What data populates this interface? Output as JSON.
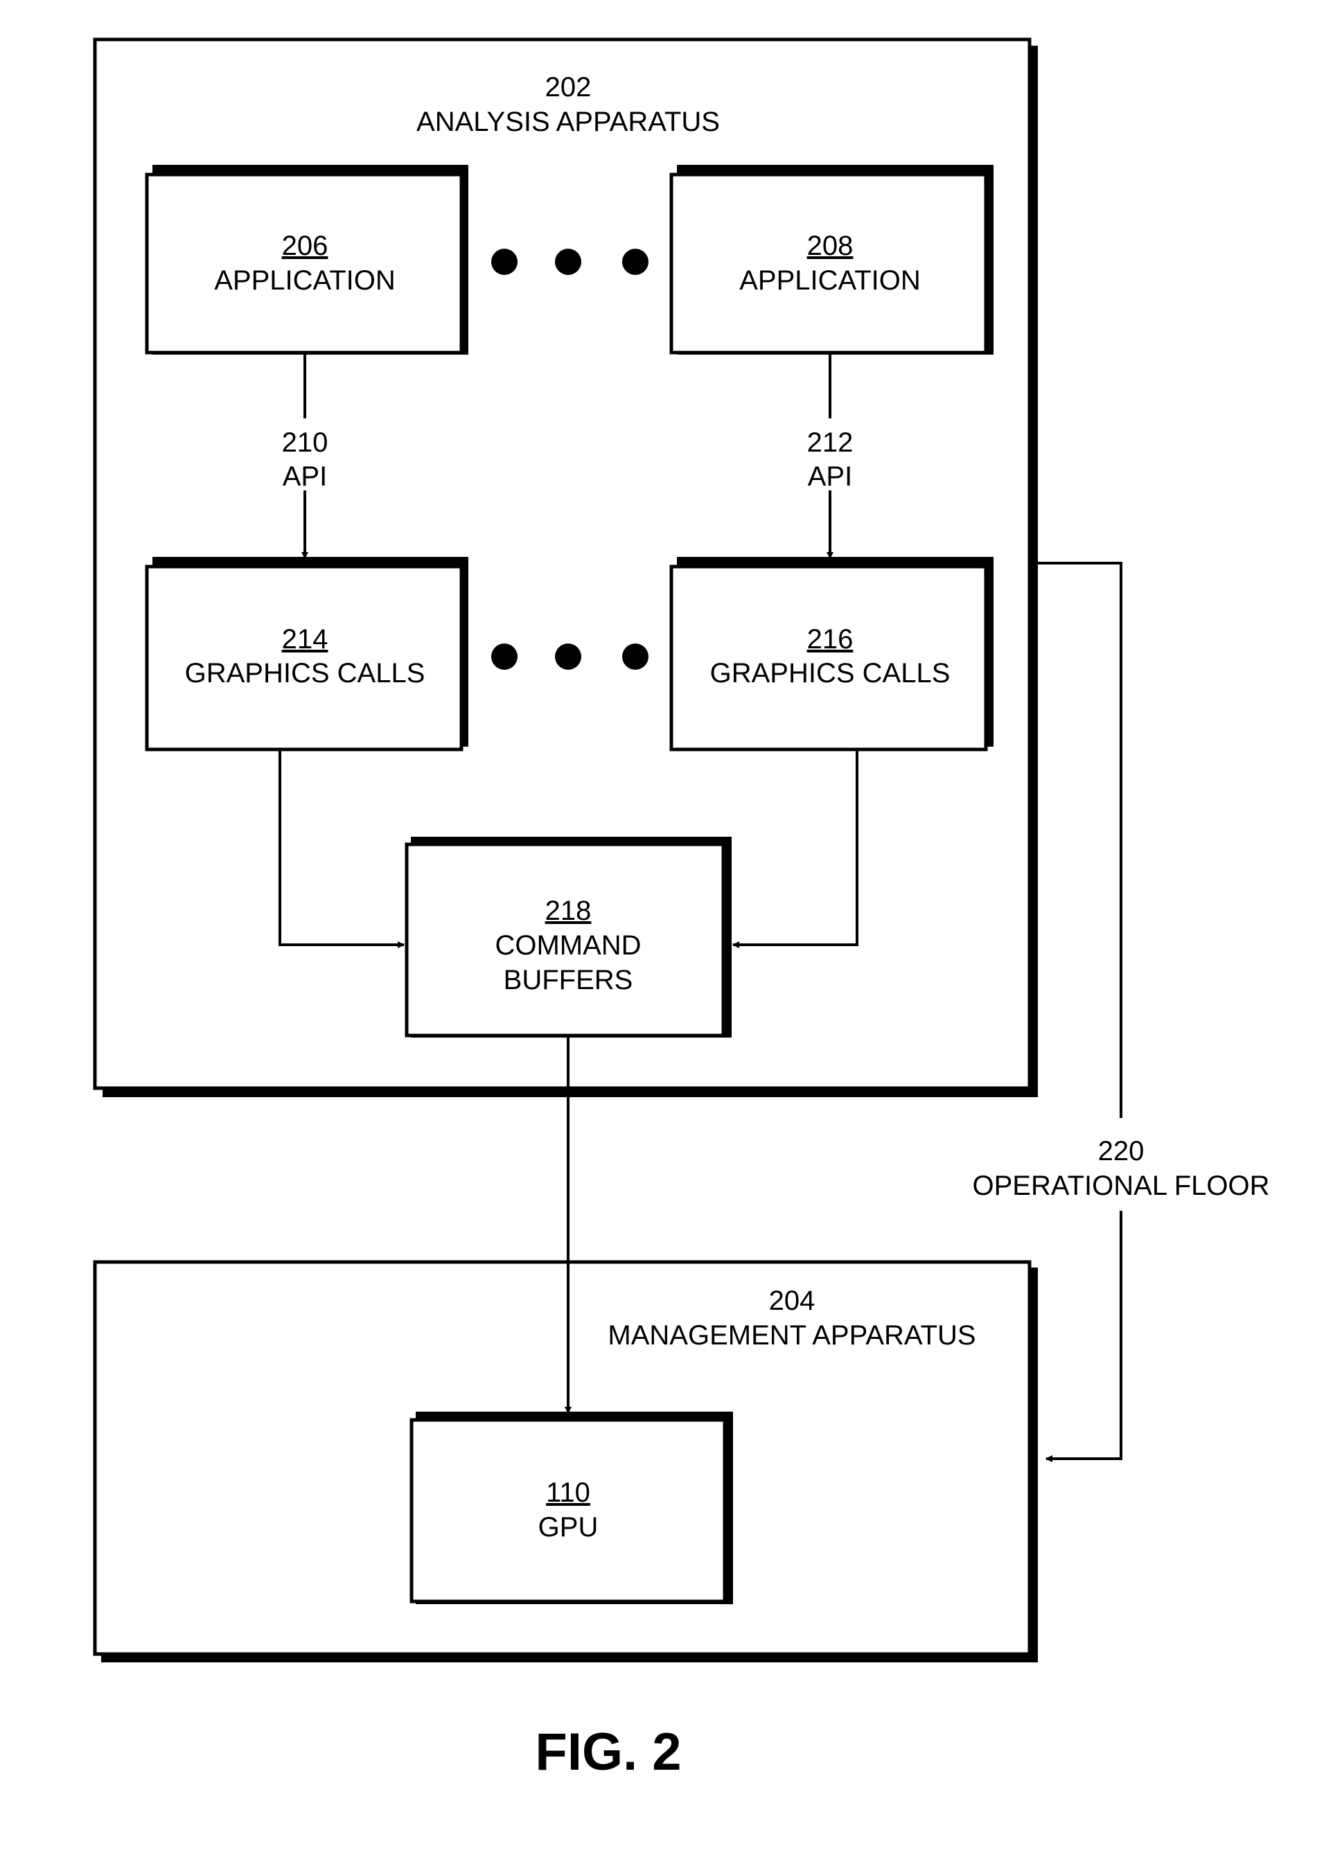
{
  "figure_label": "FIG. 2",
  "containers": {
    "analysis": {
      "ref": "202",
      "title": "ANALYSIS APPARATUS"
    },
    "management": {
      "ref": "204",
      "title": "MANAGEMENT APPARATUS"
    }
  },
  "boxes": {
    "app_206": {
      "ref": "206",
      "label": "APPLICATION"
    },
    "app_208": {
      "ref": "208",
      "label": "APPLICATION"
    },
    "gfx_214": {
      "ref": "214",
      "label": "GRAPHICS CALLS"
    },
    "gfx_216": {
      "ref": "216",
      "label": "GRAPHICS CALLS"
    },
    "cmd_218": {
      "ref": "218",
      "label_line1": "COMMAND",
      "label_line2": "BUFFERS"
    },
    "gpu_110": {
      "ref": "110",
      "label": "GPU"
    }
  },
  "connectors": {
    "api_210": {
      "ref": "210",
      "label": "API"
    },
    "api_212": {
      "ref": "212",
      "label": "API"
    },
    "floor_220": {
      "ref": "220",
      "label": "OPERATIONAL FLOOR"
    }
  },
  "ellipsis_symbol": "•••",
  "colors": {
    "stroke": "#000000",
    "background": "#ffffff"
  }
}
